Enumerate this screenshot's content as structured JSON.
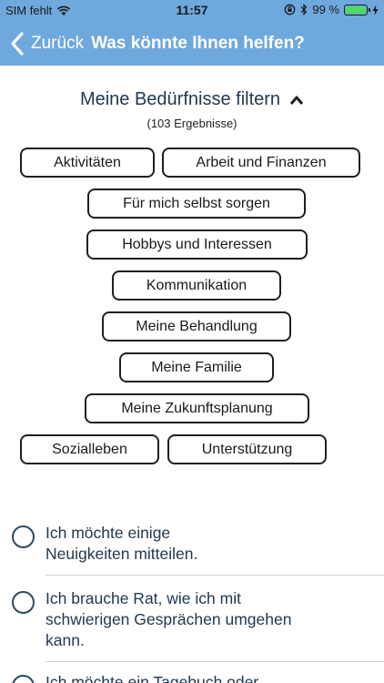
{
  "status_bar": {
    "carrier": "SIM fehlt",
    "time": "11:57",
    "battery_percent": "99 %",
    "battery_level": 0.99,
    "battery_color": "#4cd964"
  },
  "nav": {
    "back_label": "Zurück",
    "title": "Was könnte Ihnen helfen?",
    "background_color": "#6fa8dc"
  },
  "filter": {
    "title": "Meine Bedürfnisse filtern",
    "results": "(103 Ergebnisse)",
    "chips": [
      "Aktivitäten",
      "Arbeit und Finanzen",
      "Für mich selbst sorgen",
      "Hobbys und Interessen",
      "Kommunikation",
      "Meine Behandlung",
      "Meine Familie",
      "Meine Zukunftsplanung",
      "Sozialleben",
      "Unterstützung"
    ]
  },
  "list": {
    "items": [
      "Ich möchte einige\nNeuigkeiten mitteilen.",
      "Ich brauche Rat, wie ich mit\nschwierigen Gesprächen umgehen\nkann.",
      "Ich möchte ein Tagebuch oder"
    ]
  },
  "icons": {
    "wifi": "wifi-icon",
    "lock_rotation": "lock-rotation-icon",
    "bluetooth": "bluetooth-icon",
    "charging": "charging-bolt-icon",
    "back": "chevron-left-icon",
    "collapse": "chevron-up-icon",
    "radio": "radio-unchecked-icon"
  }
}
